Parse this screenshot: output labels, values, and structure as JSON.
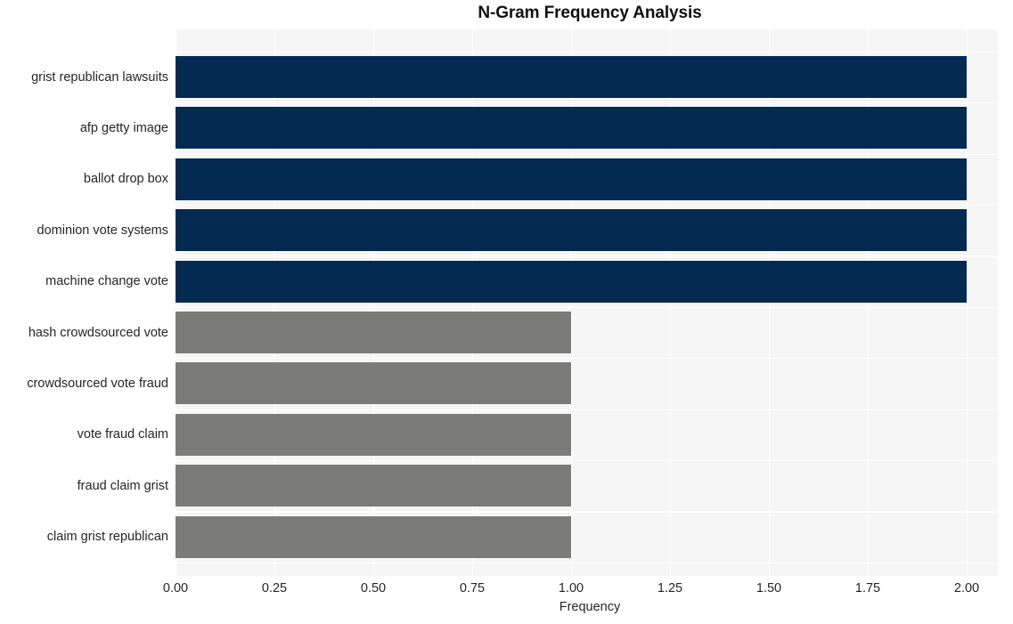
{
  "chart_data": {
    "type": "bar",
    "orientation": "horizontal",
    "title": "N-Gram Frequency Analysis",
    "xlabel": "Frequency",
    "ylabel": "",
    "xlim": [
      0,
      2
    ],
    "xticks": [
      "0.00",
      "0.25",
      "0.50",
      "0.75",
      "1.00",
      "1.25",
      "1.50",
      "1.75",
      "2.00"
    ],
    "xtick_values": [
      0,
      0.25,
      0.5,
      0.75,
      1,
      1.25,
      1.5,
      1.75,
      2
    ],
    "grid": true,
    "legend": "none",
    "categories": [
      "grist republican lawsuits",
      "afp getty image",
      "ballot drop box",
      "dominion vote systems",
      "machine change vote",
      "hash crowdsourced vote",
      "crowdsourced vote fraud",
      "vote fraud claim",
      "fraud claim grist",
      "claim grist republican"
    ],
    "values": [
      2,
      2,
      2,
      2,
      2,
      1,
      1,
      1,
      1,
      1
    ],
    "bar_colors": [
      "#052a51",
      "#052a51",
      "#052a51",
      "#052a51",
      "#052a51",
      "#7b7b79",
      "#7b7b79",
      "#7b7b79",
      "#7b7b79",
      "#7b7b79"
    ],
    "colors": {
      "navy": "#052a51",
      "gray": "#7b7b79",
      "plot_background": "#f6f6f6",
      "gridline": "#ffffff",
      "text": "#262626",
      "title": "#101010",
      "figure_background": "#ffffff"
    }
  }
}
